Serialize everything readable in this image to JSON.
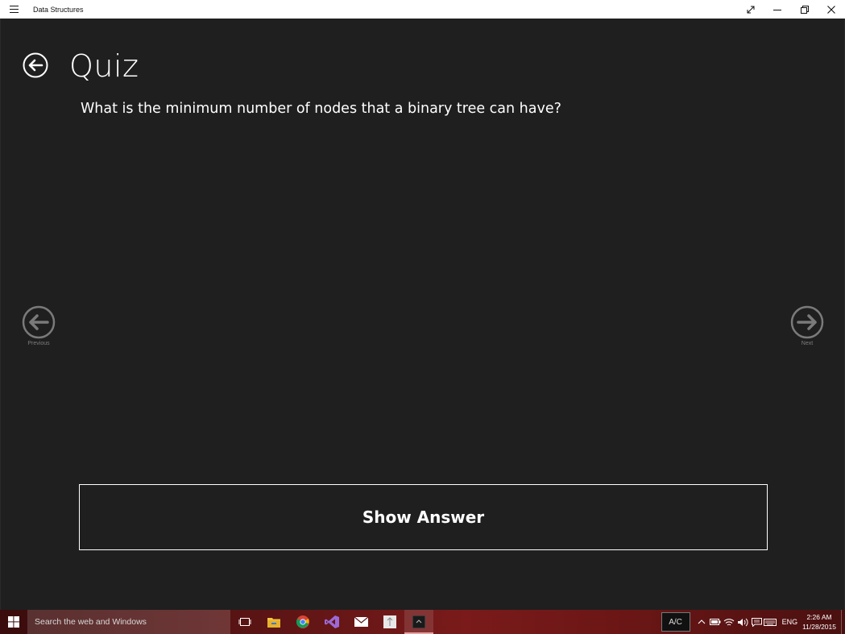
{
  "window": {
    "title": "Data Structures",
    "accent": "#ffffff",
    "background": "#1f1f1f"
  },
  "page": {
    "title": "Quiz",
    "question": "What is the minimum number of nodes that a binary tree can have?",
    "previous_label": "Previous",
    "next_label": "Next",
    "show_answer_label": "Show Answer"
  },
  "taskbar": {
    "search_placeholder": "Search the web and Windows",
    "apps": [
      {
        "name": "task-view-icon"
      },
      {
        "name": "file-explorer-icon"
      },
      {
        "name": "chrome-icon"
      },
      {
        "name": "visual-studio-icon"
      },
      {
        "name": "mail-icon"
      },
      {
        "name": "app-icon"
      },
      {
        "name": "data-structures-app-icon",
        "active": true
      }
    ],
    "ac_label": "A/C",
    "language": "ENG",
    "time": "2:26 AM",
    "date": "11/28/2015"
  }
}
